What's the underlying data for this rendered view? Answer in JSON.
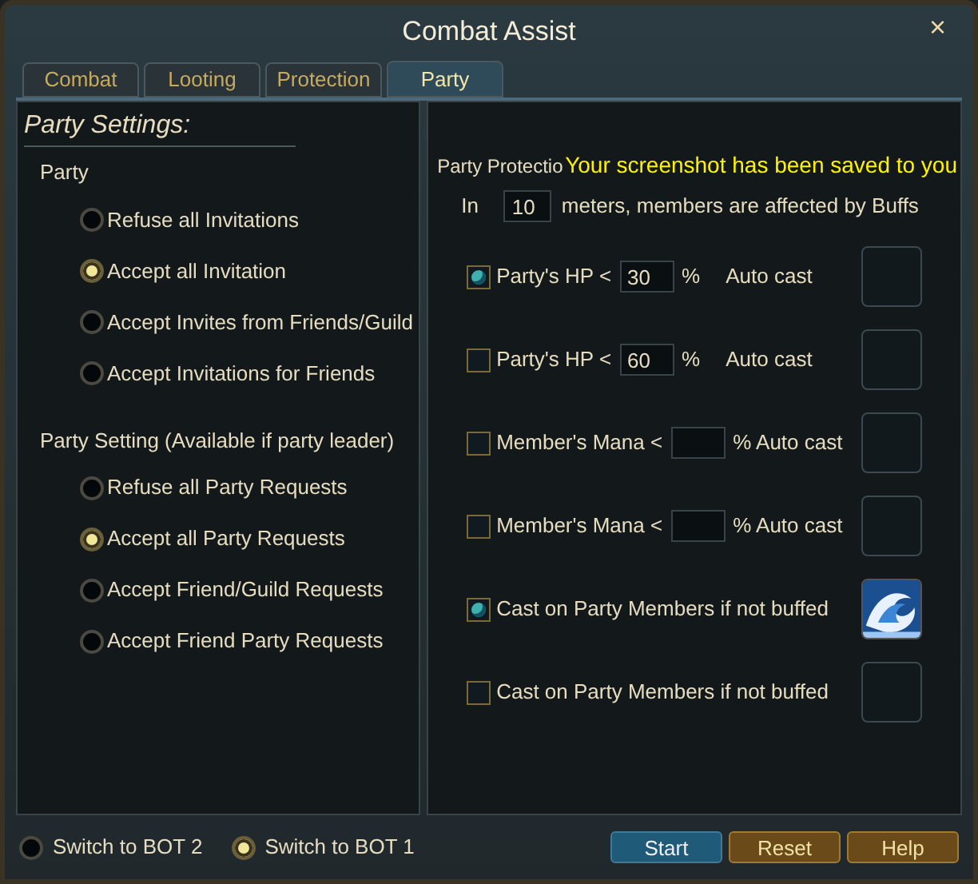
{
  "window": {
    "title": "Combat Assist",
    "close": "×"
  },
  "tabs": [
    {
      "label": "Combat",
      "selected": false
    },
    {
      "label": "Looting",
      "selected": false
    },
    {
      "label": "Protection",
      "selected": false
    },
    {
      "label": "Party",
      "selected": true
    }
  ],
  "party_settings": {
    "title": "Party Settings:",
    "groups": [
      {
        "heading": "Party",
        "options": [
          {
            "label": "Refuse all Invitations",
            "selected": false
          },
          {
            "label": "Accept all Invitation",
            "selected": true
          },
          {
            "label": "Accept Invites from Friends/Guild",
            "selected": false
          },
          {
            "label": "Accept Invitations for Friends",
            "selected": false
          }
        ]
      },
      {
        "heading": "Party Setting (Available if party leader)",
        "options": [
          {
            "label": "Refuse all Party Requests",
            "selected": false
          },
          {
            "label": "Accept all Party Requests",
            "selected": true
          },
          {
            "label": "Accept Friend/Guild Requests",
            "selected": false
          },
          {
            "label": "Accept Friend Party Requests",
            "selected": false
          }
        ]
      }
    ]
  },
  "protection": {
    "heading": "Party Protectio",
    "range": {
      "before": "In",
      "value": "10",
      "after": "meters, members are affected by Buffs"
    },
    "rows": [
      {
        "kind": "threshold",
        "checked": true,
        "label": "Party's HP <",
        "value": "30",
        "after": [
          "%",
          "Auto cast"
        ],
        "skill_set": false
      },
      {
        "kind": "threshold",
        "checked": false,
        "label": "Party's HP <",
        "value": "60",
        "after": [
          "%",
          "Auto cast"
        ],
        "skill_set": false
      },
      {
        "kind": "threshold",
        "checked": false,
        "label": "Member's Mana <",
        "after": [
          "% Auto cast"
        ],
        "skill_set": false
      },
      {
        "kind": "threshold",
        "checked": false,
        "label": "Member's Mana <",
        "after": [
          "% Auto cast"
        ],
        "skill_set": false
      },
      {
        "kind": "plain",
        "checked": true,
        "label": "Cast on Party Members if not buffed",
        "skill_set": true
      },
      {
        "kind": "plain",
        "checked": false,
        "label": "Cast on Party Members if not buffed",
        "skill_set": false
      }
    ]
  },
  "notification": "Your screenshot has been saved to you",
  "bot_switch": [
    {
      "label": "Switch to BOT 2",
      "selected": false
    },
    {
      "label": "Switch to BOT 1",
      "selected": true
    }
  ],
  "buttons": [
    {
      "label": "Start",
      "kind": "primary"
    },
    {
      "label": "Reset",
      "kind": "secondary"
    },
    {
      "label": "Help",
      "kind": "secondary"
    }
  ]
}
